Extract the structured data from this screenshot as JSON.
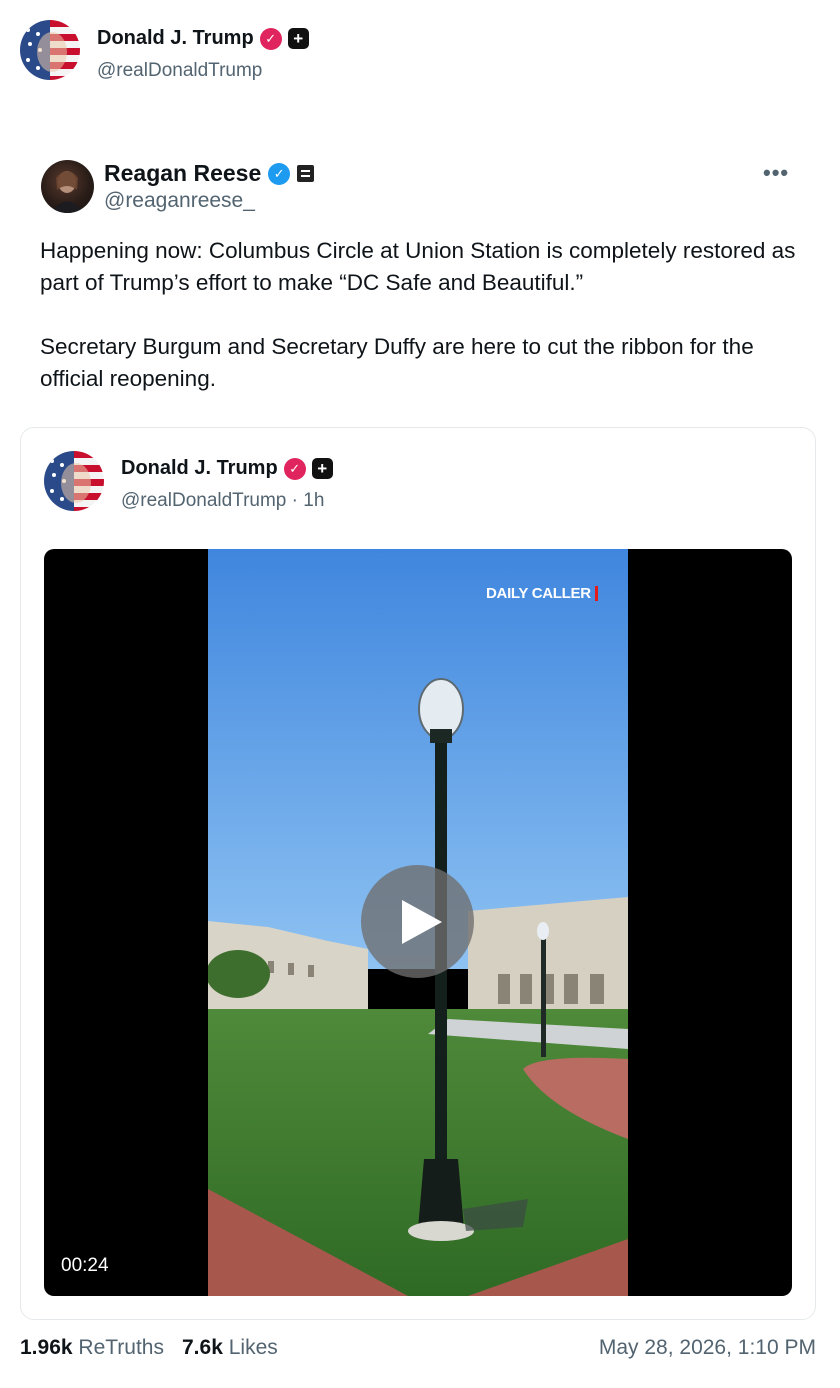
{
  "author": {
    "name": "Donald J. Trump",
    "handle": "@realDonaldTrump"
  },
  "quoted_post": {
    "name": "Reagan Reese",
    "handle": "@reaganreese_",
    "more_label": "•••",
    "paragraphs": [
      "Happening now: Columbus Circle at Union Station is completely restored as part of Trump’s effort to make “DC Safe and Beautiful.”",
      "Secretary Burgum and Secretary Duffy are here to cut the ribbon for the official reopening."
    ]
  },
  "embedded_post": {
    "name": "Donald J. Trump",
    "handle": "@realDonaldTrump",
    "separator": " · ",
    "age": "1h",
    "video": {
      "watermark": "DAILY CALLER",
      "duration": "00:24"
    }
  },
  "stats": {
    "retruths_count": "1.96k",
    "retruths_label": "ReTruths",
    "likes_count": "7.6k",
    "likes_label": "Likes",
    "timestamp": "May 28, 2026, 1:10 PM"
  },
  "icons": {
    "verified_pink": "verified-badge-icon",
    "verified_blue": "verified-badge-icon",
    "plus": "plus-badge-icon",
    "org": "affiliation-badge-icon",
    "play": "play-icon"
  },
  "colors": {
    "verified_pink": "#e0245e",
    "verified_blue": "#1d9bf0",
    "muted_text": "#536471"
  }
}
